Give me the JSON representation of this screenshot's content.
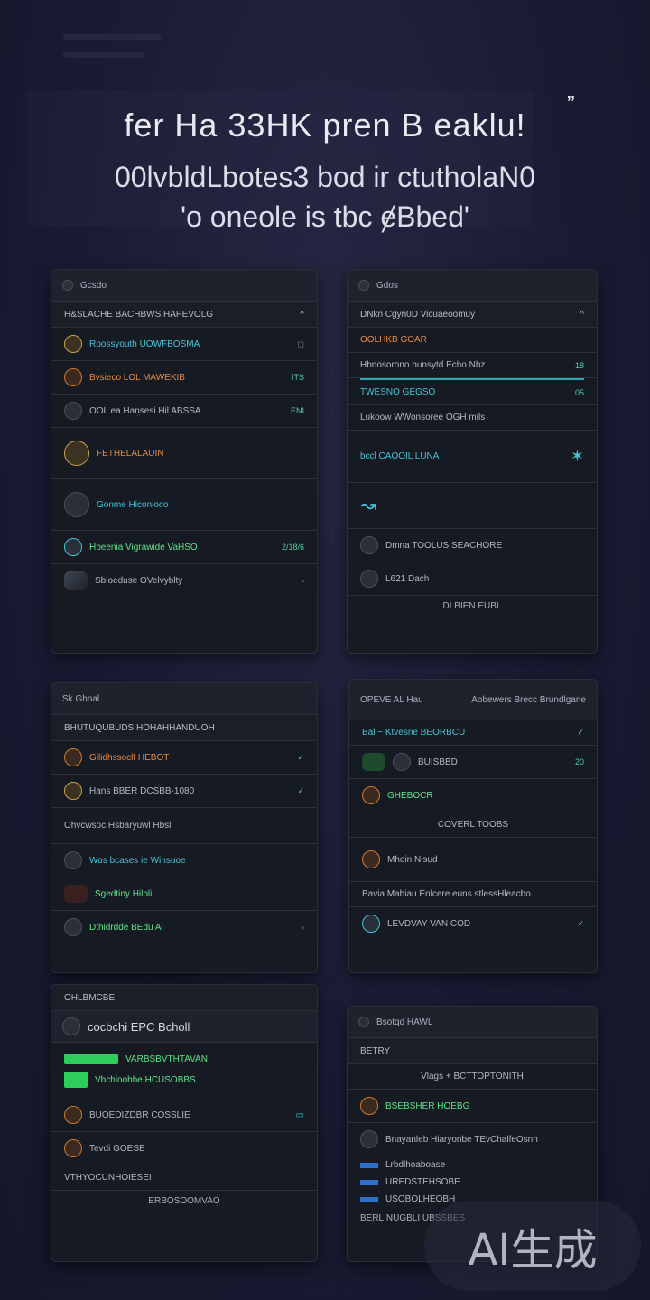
{
  "headline": {
    "line1": "fer Ha 33HK pren B eaklu!",
    "line2": "00lvbldLbotes3 bod ir ctutholaN0",
    "line3": "'o oneole is tbc ɇBbed'",
    "quote_mark": "”"
  },
  "panels": [
    {
      "title": "Gcsdo",
      "subtitle": "H&SLACHE BACHBWS HAPEVOLG",
      "rows": [
        {
          "text": "Rpossyouth UOWFBOSMA",
          "meta": "",
          "accent": "cyan"
        },
        {
          "text": "Bvsieco LOL MAWEKIB",
          "meta": "ITS",
          "accent": "orange"
        },
        {
          "text": "OOL ea Hansesi Hil ABSSA",
          "meta": "ENI",
          "accent": ""
        },
        {
          "text": "FETHELALAUIN",
          "meta": "",
          "accent": "orange"
        },
        {
          "text": "Gonme Hiconioco",
          "meta": "",
          "accent": "cyan"
        },
        {
          "text": "Hbeenia Vigrawide VaHSO",
          "meta": "2/18/6",
          "accent": "green"
        },
        {
          "text": "Sbloeduse OVelvyblty",
          "meta": "",
          "accent": ""
        }
      ]
    },
    {
      "title": "Gdos",
      "subtitle": "DNkn Cgyn0D Vicuaeoomuy",
      "rows": [
        {
          "text": "OOLHKB GOAR",
          "meta": "",
          "accent": "orange"
        },
        {
          "text": "Hbnosorono bunsytd Echo Nhz",
          "meta": "18",
          "accent": ""
        },
        {
          "text": "TWESNO GEGSO",
          "meta": "05",
          "accent": "cyan"
        },
        {
          "text": "Lukoow WWonsoree OGH mils",
          "meta": "",
          "accent": ""
        },
        {
          "text": "bccl CAOOIL LUNA",
          "meta": "",
          "accent": "cyan"
        },
        {
          "text": "Dmna TOOLUS SEACHORE",
          "meta": "",
          "accent": ""
        },
        {
          "text": "L621 Dach",
          "meta": "",
          "accent": ""
        }
      ],
      "footer": "DLBIEN EUBL"
    },
    {
      "title": "Sk Ghnal",
      "subtitle": "BHUTUQUBUDS HOHAHHANDUOH",
      "rows": [
        {
          "text": "Gllidhssoclf HEBOT",
          "meta": "",
          "accent": "orange"
        },
        {
          "text": "Hans BBER DCSBB-1080",
          "meta": "",
          "accent": ""
        },
        {
          "text": "Ohvcwsoc Hsbaryuwl Hbsl",
          "meta": "",
          "accent": ""
        },
        {
          "text": "Wos bcases ie Winsuoe",
          "meta": "",
          "accent": "cyan"
        },
        {
          "text": "Sgedtiny Hilbli",
          "meta": "",
          "accent": "green"
        },
        {
          "text": "Dthidrdde BEdu Al",
          "meta": "",
          "accent": "green"
        }
      ]
    },
    {
      "title": "OPEVE AL Hau",
      "subtitle": "Aobewers Brecc Brundlgane",
      "rows": [
        {
          "text": "Bal ~ Ktvesne BEORBCU",
          "meta": "",
          "accent": "cyan"
        },
        {
          "text": "BUISBBD",
          "meta": "20",
          "accent": ""
        },
        {
          "text": "GHEBOCR",
          "meta": "",
          "accent": "green"
        },
        {
          "text": "COVERL TOOBS",
          "meta": "",
          "accent": ""
        },
        {
          "text": "Mhoin Nisud",
          "meta": "",
          "accent": ""
        },
        {
          "text": "Bavia Mabiau Enlcere euns stlessHleacbo",
          "meta": "",
          "accent": ""
        },
        {
          "text": "LEVDVAY VAN COD",
          "meta": "",
          "accent": ""
        }
      ]
    },
    {
      "title": "cocbchi EPC Bcholl",
      "subtitle": "OHLBMCBE",
      "rows": [
        {
          "text": "VARBSBVTHTAVAN",
          "meta": "",
          "accent": "green"
        },
        {
          "text": "Vbchloobhe HCUSOBBS",
          "meta": "",
          "accent": "green"
        },
        {
          "text": "BUOEDIZDBR COSSLIE",
          "meta": "",
          "accent": ""
        },
        {
          "text": "Tevdi GOESE",
          "meta": "",
          "accent": ""
        },
        {
          "text": "VTHYOCUNHOIESEI",
          "meta": "",
          "accent": ""
        }
      ],
      "footer": "ERBOSOOMVAO"
    },
    {
      "title": "Bsotqd HAWL",
      "subtitle": "BETRY",
      "rows": [
        {
          "text": "Vlags + BCTTOPTONITH",
          "meta": "",
          "accent": ""
        },
        {
          "text": "BSEBSHER HOEBG",
          "meta": "",
          "accent": "green"
        },
        {
          "text": "Bnayanleb Hiaryonbe TEvChalfeOsnh",
          "meta": "",
          "accent": ""
        },
        {
          "text": "Lrbdlhoaboase",
          "meta": "",
          "accent": ""
        },
        {
          "text": "UREDSTEHSOBE",
          "meta": "",
          "accent": ""
        },
        {
          "text": "USOBOLHEOBH",
          "meta": "",
          "accent": ""
        }
      ],
      "footer": "BERLINUGBLI UBSSBES"
    }
  ],
  "watermark": "AI生成",
  "colors": {
    "background": "#1a1b33",
    "panel": "#161a22",
    "accent_green": "#5ce38b",
    "accent_cyan": "#3fc6d8",
    "accent_orange": "#e98a3c"
  }
}
